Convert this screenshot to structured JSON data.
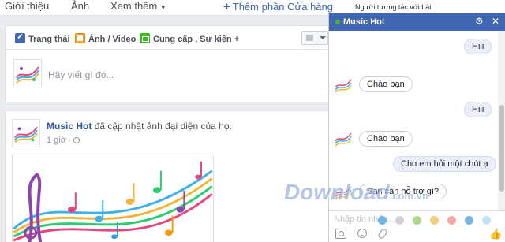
{
  "topnav": {
    "tabs": [
      "Giới thiệu",
      "Ảnh",
      "Xem thêm"
    ],
    "add_section": "Thêm phần Cửa hàng",
    "side_link": "Người tương tác với bài"
  },
  "composer": {
    "tab_status": "Trạng thái",
    "tab_photo": "Ảnh / Video",
    "tab_offer": "Cung cấp , Sự kiện +",
    "placeholder": "Hãy viết gì đó..."
  },
  "post": {
    "author": "Music Hot",
    "action": "đã cập nhật ảnh đại diện của họ.",
    "time": "1 giờ ·"
  },
  "chat": {
    "title": "Music Hot",
    "messages": [
      {
        "from": "me",
        "text": "Hiii"
      },
      {
        "from": "them",
        "text": "Chào bạn"
      },
      {
        "from": "me",
        "text": "Hiii"
      },
      {
        "from": "them",
        "text": "Chào bạn"
      },
      {
        "from": "me",
        "text": "Cho em hỏi một chút ạ"
      },
      {
        "from": "them",
        "text": "Bạn cần hỗ trợ gì?"
      }
    ],
    "input_placeholder": "Nhập tin nhắn...",
    "color_swatches": [
      "#6bb8e6",
      "#cfd2d6",
      "#a9d989",
      "#f2cf7c",
      "#f2a9a0",
      "#76b4e4",
      "#bfe3f5"
    ]
  },
  "colors": {
    "brand": "#4267b2",
    "link": "#365899",
    "online": "#42b72a"
  },
  "watermark": {
    "text": "Download",
    "suffix": ".com.vn"
  }
}
